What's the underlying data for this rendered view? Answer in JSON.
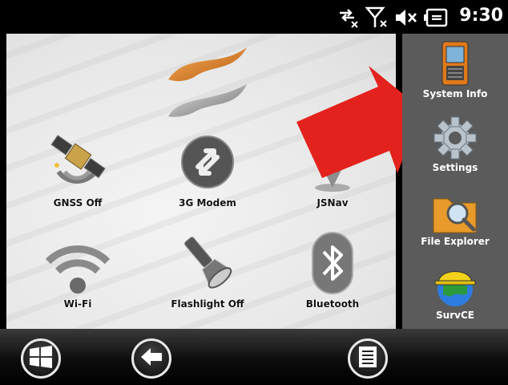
{
  "status_bar": {
    "icons": [
      "connectivity-icon",
      "no-signal-icon",
      "volume-muted-icon",
      "battery-charging-icon"
    ],
    "time": "9:30"
  },
  "main_tiles": [
    {
      "label": "",
      "icon": "app-logo-icon"
    },
    {
      "label": "GNSS Off",
      "icon": "satellite-icon"
    },
    {
      "label": "3G Modem",
      "icon": "modem-arrows-icon"
    },
    {
      "label": "JSNav",
      "icon": "map-pin-icon"
    },
    {
      "label": "Wi-Fi",
      "icon": "wifi-icon"
    },
    {
      "label": "Flashlight Off",
      "icon": "flashlight-icon"
    },
    {
      "label": "Bluetooth",
      "icon": "bluetooth-icon"
    }
  ],
  "side_panel": [
    {
      "label": "System Info",
      "icon": "device-icon"
    },
    {
      "label": "Settings",
      "icon": "gear-icon"
    },
    {
      "label": "File Explorer",
      "icon": "folder-magnifier-icon"
    },
    {
      "label": "SurvCE",
      "icon": "globe-hardhat-icon"
    }
  ],
  "taskbar": {
    "buttons": [
      "windows-start-icon",
      "back-arrow-icon",
      "menu-list-icon"
    ]
  },
  "colors": {
    "side_panel_bg": "#5b5b5b",
    "annotation_arrow": "#e4221d",
    "status_bar_bg": "#000000"
  }
}
